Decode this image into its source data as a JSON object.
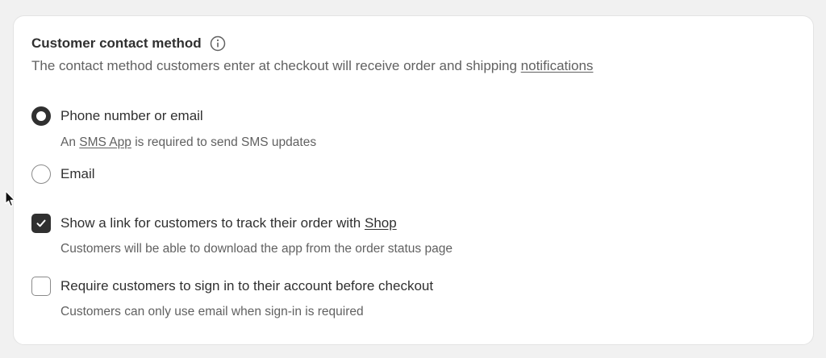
{
  "section": {
    "title": "Customer contact method",
    "info_icon": "info-icon",
    "description_prefix": "The contact method customers enter at checkout will receive order and shipping ",
    "description_link": "notifications"
  },
  "contact_options": [
    {
      "label": "Phone number or email",
      "selected": true,
      "help_prefix": "An ",
      "help_link": "SMS App",
      "help_suffix": " is required to send SMS updates"
    },
    {
      "label": "Email",
      "selected": false
    }
  ],
  "checkboxes": [
    {
      "label_prefix": "Show a link for customers to track their order with ",
      "label_link": "Shop",
      "checked": true,
      "help": "Customers will be able to download the app from the order status page"
    },
    {
      "label": "Require customers to sign in to their account before checkout",
      "checked": false,
      "help": "Customers can only use email when sign-in is required"
    }
  ],
  "colors": {
    "page_background": "#f1f1f1",
    "card_background": "#ffffff",
    "text_primary": "#303030",
    "text_secondary": "#616161"
  }
}
